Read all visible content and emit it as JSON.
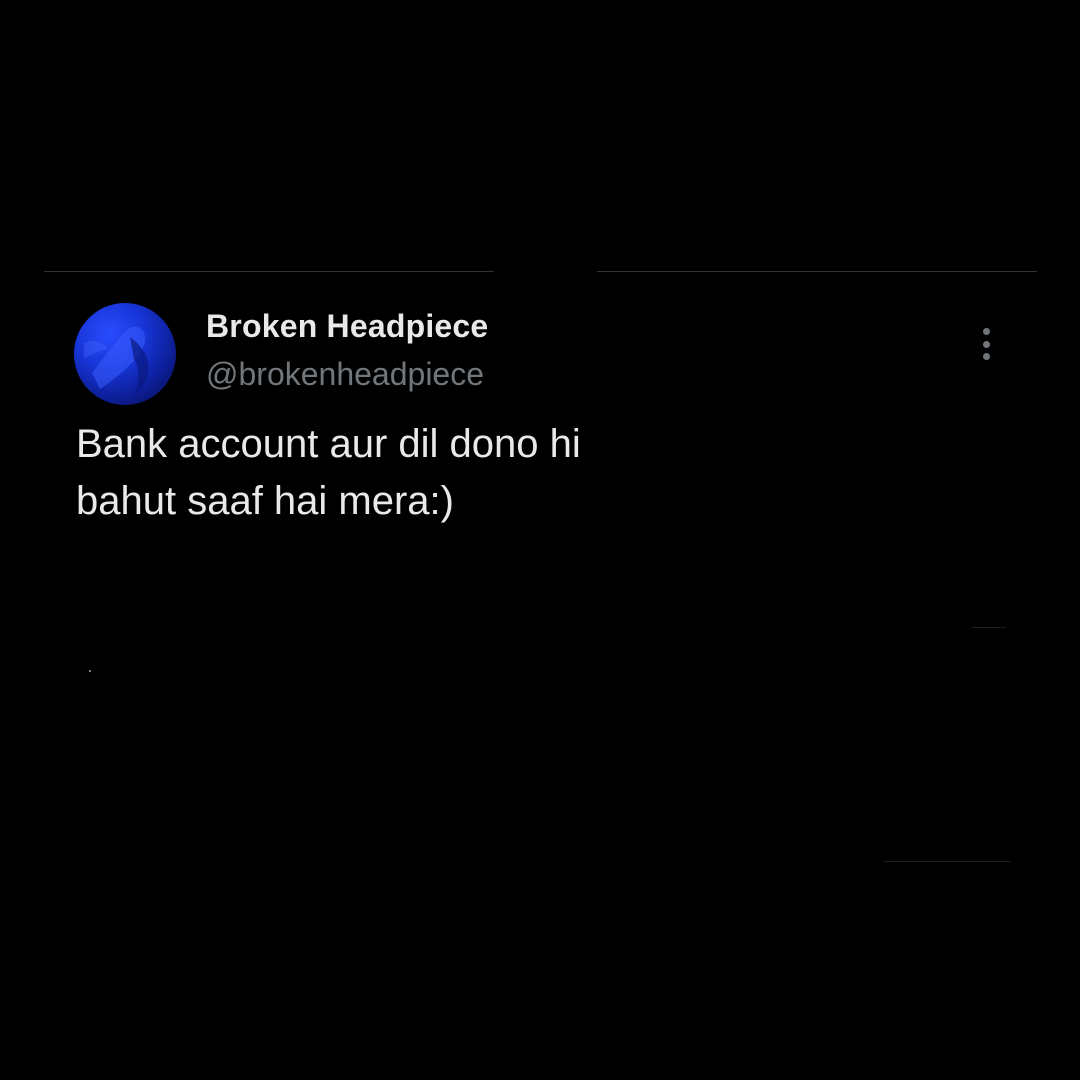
{
  "tweet": {
    "author": {
      "name": "Broken Headpiece",
      "handle": "@brokenheadpiece",
      "avatar_icon": "profile-avatar-blue"
    },
    "text": "Bank account aur dil dono hi\nbahut saaf hai mera:)",
    "more_icon": "more-vertical-icon"
  },
  "colors": {
    "background": "#000000",
    "name_text": "#e7e9ea",
    "handle_text": "#71767b",
    "divider": "#2f3336",
    "avatar_accent": "#1736d8"
  }
}
